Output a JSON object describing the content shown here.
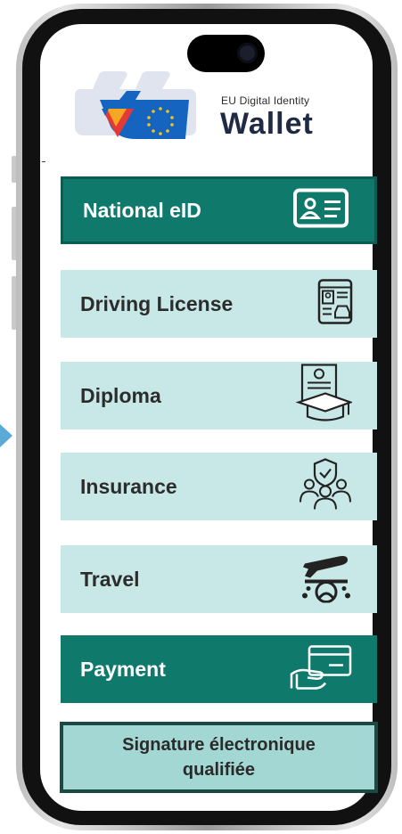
{
  "logo": {
    "small_text": "EU Digital Identity",
    "big_text": "Wallet"
  },
  "cards": [
    {
      "label": "National eID",
      "icon": "id-card-icon",
      "style": "dark"
    },
    {
      "label": "Driving License",
      "icon": "driving-license-icon",
      "style": "light"
    },
    {
      "label": "Diploma",
      "icon": "diploma-icon",
      "style": "light"
    },
    {
      "label": "Insurance",
      "icon": "insurance-icon",
      "style": "light"
    },
    {
      "label": "Travel",
      "icon": "travel-icon",
      "style": "light"
    },
    {
      "label": "Payment",
      "icon": "payment-card-icon",
      "style": "dark"
    }
  ],
  "signature": {
    "line1": "Signature électronique",
    "line2": "qualifiée"
  },
  "colors": {
    "dark_teal": "#0f7a6c",
    "light_teal": "#c7e8e6",
    "signature_bg": "#a3d7d3",
    "logo_navy": "#1f2a44",
    "logo_blue": "#1565c0",
    "logo_yellow": "#f5c518",
    "logo_red": "#e53935"
  }
}
